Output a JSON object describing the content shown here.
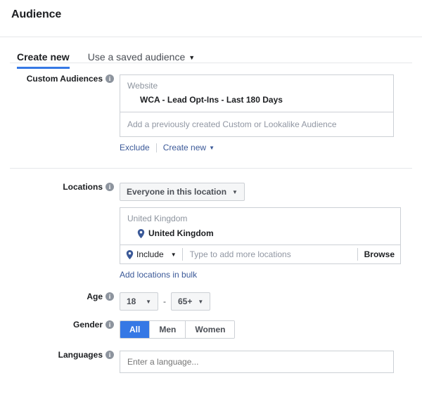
{
  "header": {
    "title": "Audience"
  },
  "tabs": [
    {
      "label": "Create new",
      "active": true,
      "caret": ""
    },
    {
      "label": "Use a saved audience",
      "active": false,
      "caret": "▼"
    }
  ],
  "custom_audiences": {
    "label": "Custom Audiences",
    "info": "i",
    "group_title": "Website",
    "selected_item": "WCA - Lead Opt-Ins - Last 180 Days",
    "placeholder": "Add a previously created Custom or Lookalike Audience",
    "exclude_link": "Exclude",
    "create_new_link": "Create new",
    "create_new_caret": "▼"
  },
  "locations": {
    "label": "Locations",
    "info": "i",
    "scope_button": "Everyone in this location",
    "scope_caret": "▼",
    "group_title": "United Kingdom",
    "selected_item": "United Kingdom",
    "include_label": "Include",
    "include_caret": "▼",
    "typeahead_placeholder": "Type to add more locations",
    "browse_label": "Browse",
    "bulk_link": "Add locations in bulk"
  },
  "age": {
    "label": "Age",
    "info": "i",
    "min": "18",
    "max": "65+",
    "separator": "-",
    "caret": "▼"
  },
  "gender": {
    "label": "Gender",
    "info": "i",
    "options": [
      {
        "label": "All",
        "selected": true
      },
      {
        "label": "Men",
        "selected": false
      },
      {
        "label": "Women",
        "selected": false
      }
    ]
  },
  "languages": {
    "label": "Languages",
    "info": "i",
    "placeholder": "Enter a language...",
    "value": ""
  },
  "colors": {
    "accent_blue": "#3578e5",
    "link_blue": "#3b5998",
    "border": "#ccd0d5",
    "rule": "#e5e7ea",
    "muted_text": "#8d949e",
    "text": "#1c1e21"
  }
}
